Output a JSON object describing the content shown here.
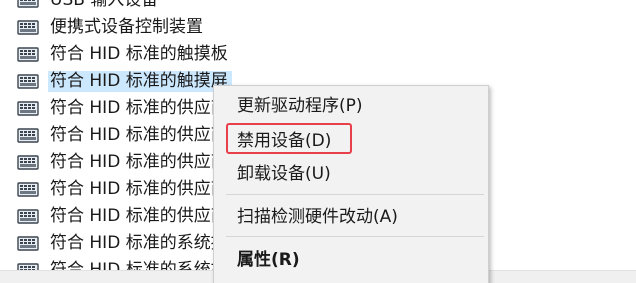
{
  "tree": {
    "items": [
      {
        "label": "USB 输入设备",
        "icon": "keyboard-icon",
        "selected": false
      },
      {
        "label": "便携式设备控制装置",
        "icon": "keyboard-icon",
        "selected": false
      },
      {
        "label": "符合 HID 标准的触摸板",
        "icon": "keyboard-icon",
        "selected": false
      },
      {
        "label": "符合 HID 标准的触摸屏",
        "icon": "keyboard-icon",
        "selected": true
      },
      {
        "label": "符合 HID 标准的供应商定义设备",
        "icon": "keyboard-icon",
        "selected": false
      },
      {
        "label": "符合 HID 标准的供应商定义设备",
        "icon": "keyboard-icon",
        "selected": false
      },
      {
        "label": "符合 HID 标准的供应商定义设备",
        "icon": "keyboard-icon",
        "selected": false
      },
      {
        "label": "符合 HID 标准的供应商定义设备",
        "icon": "keyboard-icon",
        "selected": false
      },
      {
        "label": "符合 HID 标准的供应商定义设备",
        "icon": "keyboard-icon",
        "selected": false
      },
      {
        "label": "符合 HID 标准的系统控制器",
        "icon": "keyboard-icon",
        "selected": false
      },
      {
        "label": "符合 HID 标准的系统控制器",
        "icon": "keyboard-icon",
        "selected": false
      }
    ]
  },
  "context_menu": {
    "items": [
      {
        "label": "更新驱动程序(P)",
        "bold": false
      },
      {
        "label": "禁用设备(D)",
        "bold": false,
        "highlighted": true
      },
      {
        "label": "卸载设备(U)",
        "bold": false
      },
      {
        "label": "扫描检测硬件改动(A)",
        "bold": false
      },
      {
        "label": "属性(R)",
        "bold": true
      }
    ]
  },
  "colors": {
    "selection": "#cce8ff",
    "highlight_box": "#e8404a",
    "menu_bg": "#f2f2f2"
  }
}
